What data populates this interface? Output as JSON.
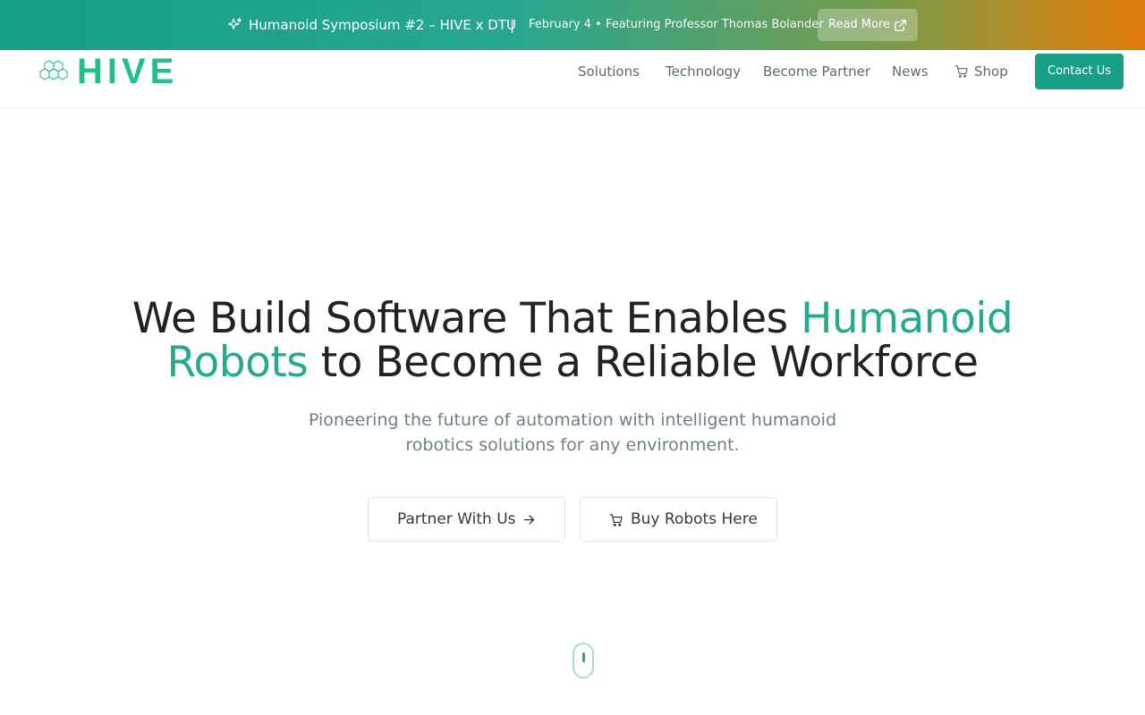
{
  "banner": {
    "title": "Humanoid Symposium #2 – HIVE x DTU",
    "separator": "|",
    "subtitle": "February 4 • Featuring Professor Thomas Bolander",
    "read_more_label": "Read More",
    "icons": {
      "leading": "sparkle-icon",
      "trailing": "external-link-icon"
    }
  },
  "header": {
    "logo_text": "HIVE",
    "nav": [
      {
        "label": "Solutions"
      },
      {
        "label": "Technology"
      },
      {
        "label": "Become Partner"
      },
      {
        "label": "News"
      },
      {
        "label": "Shop",
        "icon": "cart-icon"
      }
    ],
    "contact_label": "Contact Us"
  },
  "hero": {
    "title_part1": "We Build Software That Enables ",
    "title_accent": "Humanoid Robots",
    "title_part2": " to Become a Reliable Workforce",
    "subtitle": "Pioneering the future of automation with intelligent humanoid robotics solutions for any environment.",
    "primary_button": "Partner With Us",
    "secondary_button": "Buy Robots Here"
  },
  "colors": {
    "brand": "#17a085",
    "accent_text": "#25aa8f",
    "banner_gradient_start": "#16a085",
    "banner_gradient_end": "#e07b08"
  }
}
